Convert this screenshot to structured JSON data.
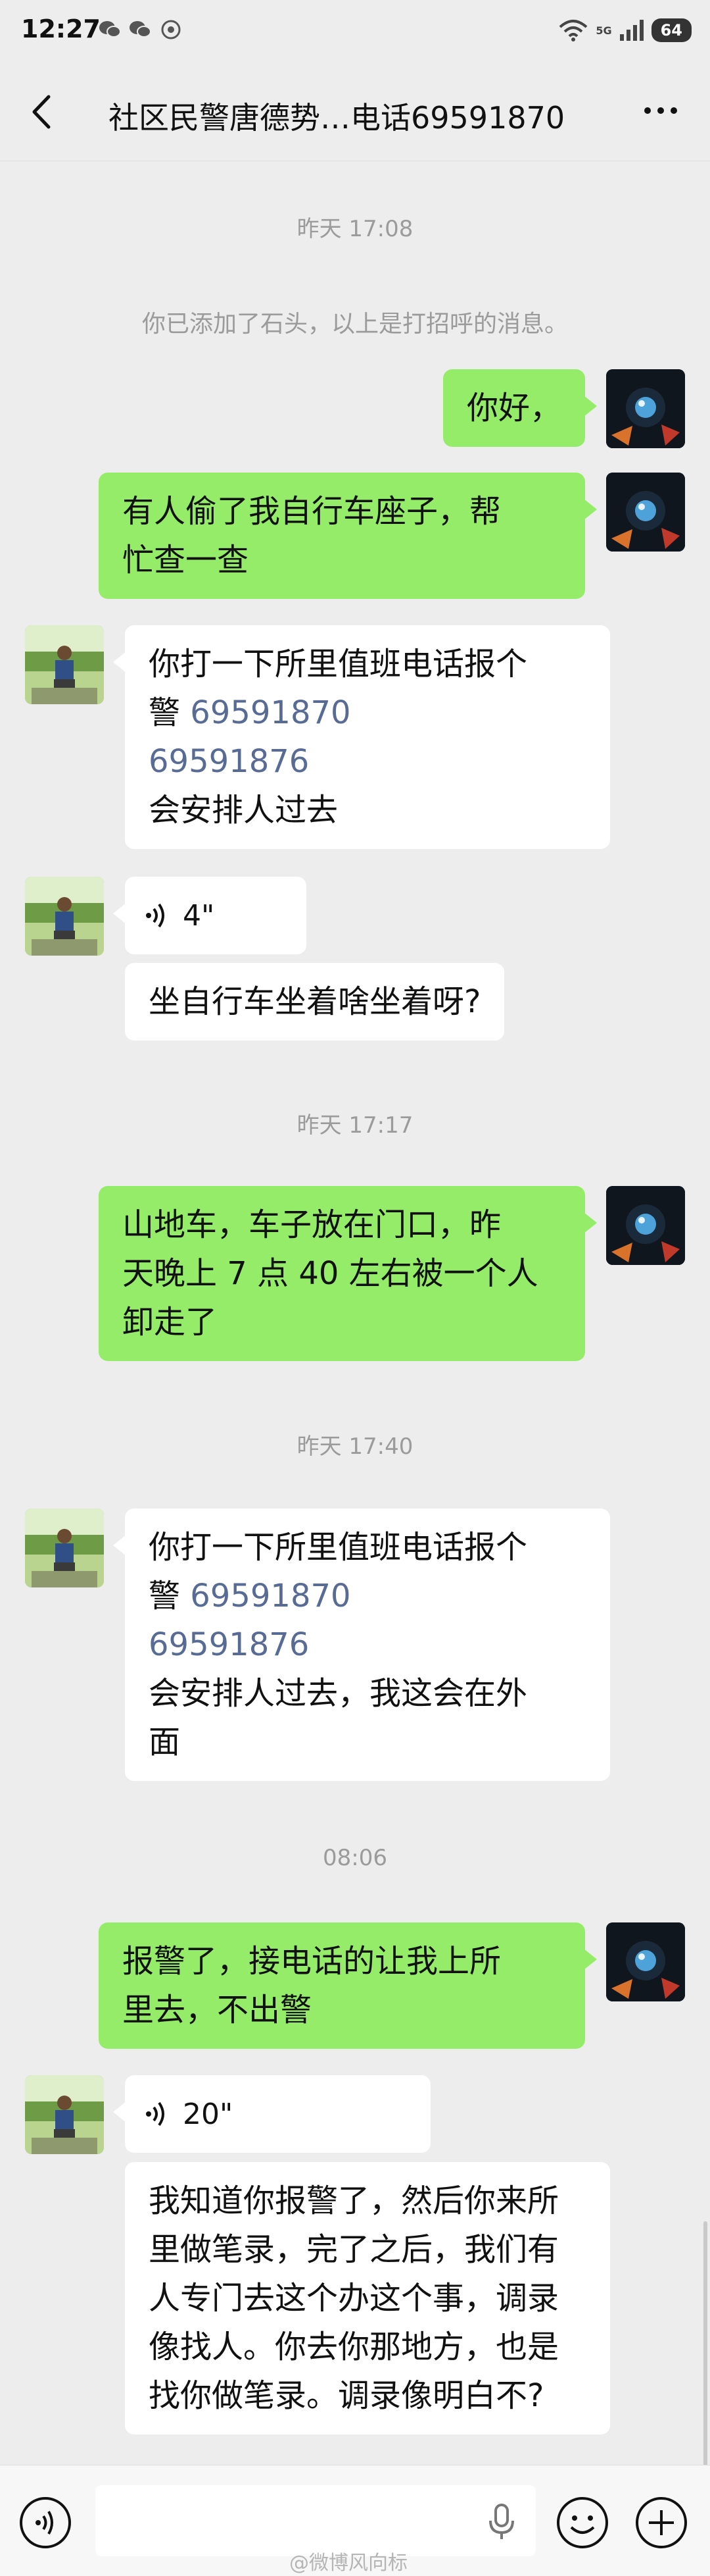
{
  "status": {
    "time": "12:27",
    "battery": "64",
    "network_label": "5G"
  },
  "nav": {
    "title": "社区民警唐德势…电话69591870"
  },
  "messages": {
    "ts1": "昨天 17:08",
    "system": "你已添加了石头，以上是打招呼的消息。",
    "m1": "你好，",
    "m2_l1": "有人偷了我自行车座子，帮",
    "m2_l2": "忙查一查",
    "m3_l1": "你打一下所里值班电话报个",
    "m3_l2a": "警 ",
    "m3_phone1": "69591870",
    "m3_phone2": "69591876",
    "m3_l4": "会安排人过去",
    "voice1": "4\"",
    "m4": "坐自行车坐着啥坐着呀?",
    "ts2": "昨天 17:17",
    "m5_l1": "山地车，车子放在门口，昨",
    "m5_l2": "天晚上 7 点 40 左右被一个人",
    "m5_l3": "卸走了",
    "ts3": "昨天 17:40",
    "m6_l1": "你打一下所里值班电话报个",
    "m6_l2a": "警 ",
    "m6_phone1": "69591870",
    "m6_phone2": "69591876",
    "m6_l4": "会安排人过去，我这会在外",
    "m6_l5": "面",
    "ts4": "08:06",
    "m7_l1": "报警了，接电话的让我上所",
    "m7_l2": "里去，不出警",
    "voice2": "20\"",
    "m8_l1": "我知道你报警了，然后你来所",
    "m8_l2": "里做笔录，完了之后，我们有",
    "m8_l3": "人专门去这个办这个事，调录",
    "m8_l4": "像找人。你去你那地方，也是",
    "m8_l5": "找你做笔录。调录像明白不?"
  },
  "watermark": "@微博风向标",
  "colors": {
    "background": "#ededed",
    "self_bubble": "#95ec69",
    "other_bubble": "#ffffff",
    "phone_link": "#576b95",
    "timestamp": "#9b9b9b"
  },
  "icons": {
    "back": "chevron-left-icon",
    "more": "more-dots-icon",
    "voice_mode": "voice-mode-icon",
    "mic": "mic-icon",
    "emoji": "emoji-icon",
    "plus": "plus-icon"
  }
}
